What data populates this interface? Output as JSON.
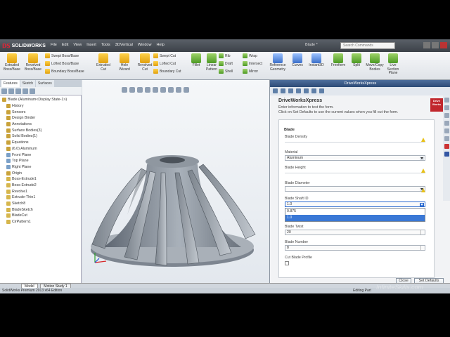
{
  "app": {
    "logo_text": "SOLIDWORKS",
    "menus": [
      "File",
      "Edit",
      "View",
      "Insert",
      "Tools",
      "3DVertical",
      "Window",
      "Help"
    ],
    "doc_title": "Blade *",
    "search_placeholder": "Search Commands"
  },
  "command_manager": {
    "big_buttons": [
      {
        "label": "Extruded Boss/Base",
        "icon": "extrude-boss-icon"
      },
      {
        "label": "Revolved Boss/Base",
        "icon": "revolve-boss-icon"
      },
      {
        "label": "Extruded Cut",
        "icon": "extruded-cut-icon"
      },
      {
        "label": "Hole Wizard",
        "icon": "hole-wizard-icon"
      },
      {
        "label": "Revolved Cut",
        "icon": "revolved-cut-icon"
      },
      {
        "label": "Fillet",
        "icon": "fillet-icon"
      },
      {
        "label": "Linear Pattern",
        "icon": "linear-pattern-icon"
      },
      {
        "label": "Reference Geometry",
        "icon": "reference-geometry-icon"
      },
      {
        "label": "Curves",
        "icon": "curves-icon"
      },
      {
        "label": "Instant3D",
        "icon": "instant3d-icon"
      },
      {
        "label": "Freeform",
        "icon": "freeform-icon"
      },
      {
        "label": "Split",
        "icon": "split-icon"
      },
      {
        "label": "Move/Copy Bodies",
        "icon": "move-copy-icon"
      },
      {
        "label": "Live Section Plane",
        "icon": "section-plane-icon"
      }
    ],
    "small_col1": [
      "Swept Boss/Base",
      "Lofted Boss/Base",
      "Boundary Boss/Base"
    ],
    "small_col2": [
      "Swept Cut",
      "Lofted Cut",
      "Boundary Cut"
    ],
    "small_col3": [
      "Rib",
      "Draft",
      "Shell"
    ],
    "small_col4": [
      "Wrap",
      "Intersect",
      "Mirror"
    ]
  },
  "feature_manager": {
    "tabs": [
      "Features",
      "Sketch",
      "Surfaces"
    ],
    "tree": [
      "Blade (Aluminum<Display State-1>)",
      "History",
      "Sensors",
      "Design Binder",
      "Annotations",
      "Surface Bodies(3)",
      "Solid Bodies(1)",
      "Equations",
      "(6.0) Aluminum",
      "Front Plane",
      "Top Plane",
      "Right Plane",
      "Origin",
      "Boss-Extrude1",
      "Boss-Extrude2",
      "Revolve1",
      "Extrude-Thin1",
      "Sketch8",
      "BladeSketch",
      "BladeCut",
      "CirPattern1"
    ]
  },
  "bottom_tabs": [
    "Model",
    "Motion Study 1"
  ],
  "status": {
    "left": "SolidWorks Premium 2013 x64 Edition",
    "right": "Editing Part"
  },
  "task_pane": {
    "header": "DriveWorksXpress",
    "title": "DriveWorksXpress",
    "subtitle1": "Enter information to test the form.",
    "subtitle2": "Click on Set Defaults to use the current values when you fill out the form.",
    "logo_text": [
      "Drive",
      "Works"
    ],
    "form_title": "Blade",
    "fields": [
      {
        "label": "Blade Density",
        "value": "",
        "type": "text",
        "warn": true
      },
      {
        "label": "Material",
        "value": "Aluminum",
        "type": "dropdown",
        "warn": false
      },
      {
        "label": "Blade Height",
        "value": "",
        "type": "text",
        "warn": true
      },
      {
        "label": "Blade Diameter",
        "value": "",
        "type": "dropdown",
        "warn": true
      },
      {
        "label": "Blade Shaft ID",
        "value": "1.0",
        "type": "dropdown-open",
        "warn": false
      },
      {
        "label": "Blade Twist",
        "value": "20",
        "type": "spin",
        "warn": false
      },
      {
        "label": "Blade Number",
        "value": "8",
        "type": "spin",
        "warn": false
      },
      {
        "label": "Cut Blade Profile",
        "value": "",
        "type": "checkbox",
        "warn": false
      }
    ],
    "dropdown_options": [
      "0.875",
      "1.0"
    ],
    "dropdown_selected": 1,
    "buttons": {
      "close": "Close",
      "set_defaults": "Set Defaults"
    }
  },
  "watermark": "InfiniteSkills.com",
  "colors": {
    "accent": "#2c6bd0",
    "brand_red": "#c1272d",
    "warning": "#e8c11a",
    "header_blue": "#2c4a76"
  }
}
